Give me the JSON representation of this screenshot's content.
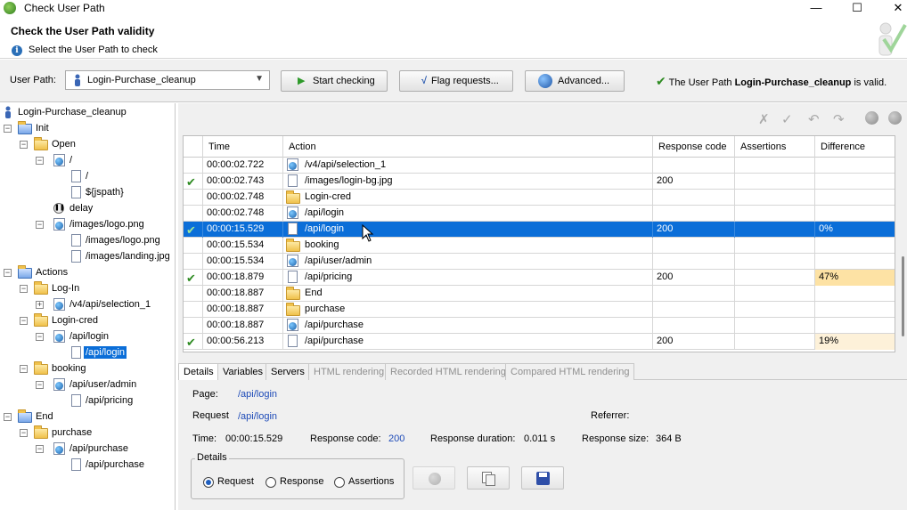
{
  "window": {
    "title": "Check User Path",
    "minimize": "—",
    "maximize": "☐",
    "close": "✕"
  },
  "header": {
    "title": "Check the User Path validity",
    "subtitle": "Select the User Path to check"
  },
  "toolbar": {
    "user_path_label": "User Path:",
    "user_path_value": "Login-Purchase_cleanup",
    "start_checking": "Start checking",
    "flag_requests": "Flag requests...",
    "advanced": "Advanced...",
    "valid_prefix": "The User Path ",
    "valid_name": "Login-Purchase_cleanup",
    "valid_suffix": " is valid."
  },
  "tree": {
    "root": "Login-Purchase_cleanup",
    "init": "Init",
    "open": "Open",
    "slash": "/",
    "slash_child": "/",
    "jspath": "${jspath}",
    "delay": "delay",
    "images_logo": "/images/logo.png",
    "images_logo_child": "/images/logo.png",
    "images_landing": "/images/landing.jpg",
    "actions": "Actions",
    "log_in": "Log-In",
    "selection_1": "/v4/api/selection_1",
    "login_cred": "Login-cred",
    "api_login": "/api/login",
    "api_login_child": "/api/login",
    "booking": "booking",
    "api_user_admin": "/api/user/admin",
    "api_pricing": "/api/pricing",
    "end": "End",
    "purchase": "purchase",
    "api_purchase": "/api/purchase",
    "api_purchase_child": "/api/purchase"
  },
  "grid": {
    "columns": [
      "Time",
      "Action",
      "Response code",
      "Assertions",
      "Difference"
    ],
    "rows": [
      {
        "check": "",
        "time": "00:00:02.722",
        "icon": "globe",
        "action": "/v4/api/selection_1",
        "code": "",
        "assertions": "",
        "difference": ""
      },
      {
        "check": "✔",
        "time": "00:00:02.743",
        "icon": "page",
        "action": "/images/login-bg.jpg",
        "code": "200",
        "assertions": "",
        "difference": ""
      },
      {
        "check": "",
        "time": "00:00:02.748",
        "icon": "folder",
        "action": "Login-cred",
        "code": "",
        "assertions": "",
        "difference": ""
      },
      {
        "check": "",
        "time": "00:00:02.748",
        "icon": "globe",
        "action": "/api/login",
        "code": "",
        "assertions": "",
        "difference": ""
      },
      {
        "check": "✔",
        "time": "00:00:15.529",
        "icon": "page",
        "action": "/api/login",
        "code": "200",
        "assertions": "",
        "difference": "0%"
      },
      {
        "check": "",
        "time": "00:00:15.534",
        "icon": "folder",
        "action": "booking",
        "code": "",
        "assertions": "",
        "difference": ""
      },
      {
        "check": "",
        "time": "00:00:15.534",
        "icon": "globe",
        "action": "/api/user/admin",
        "code": "",
        "assertions": "",
        "difference": ""
      },
      {
        "check": "✔",
        "time": "00:00:18.879",
        "icon": "page",
        "action": "/api/pricing",
        "code": "200",
        "assertions": "",
        "difference": "47%"
      },
      {
        "check": "",
        "time": "00:00:18.887",
        "icon": "folder",
        "action": "End",
        "code": "",
        "assertions": "",
        "difference": ""
      },
      {
        "check": "",
        "time": "00:00:18.887",
        "icon": "folder",
        "action": "purchase",
        "code": "",
        "assertions": "",
        "difference": ""
      },
      {
        "check": "",
        "time": "00:00:18.887",
        "icon": "globe",
        "action": "/api/purchase",
        "code": "",
        "assertions": "",
        "difference": ""
      },
      {
        "check": "✔",
        "time": "00:00:56.213",
        "icon": "page",
        "action": "/api/purchase",
        "code": "200",
        "assertions": "",
        "difference": "19%"
      }
    ]
  },
  "tabs": [
    "Details",
    "Variables",
    "Servers",
    "HTML rendering",
    "Recorded HTML rendering",
    "Compared HTML rendering"
  ],
  "details": {
    "page_label": "Page:",
    "page_value": "/api/login",
    "request_label": "Request",
    "request_value": "/api/login",
    "referrer_label": "Referrer:",
    "time_label": "Time:",
    "time_value": "00:00:15.529",
    "response_code_label": "Response code:",
    "response_code_value": "200",
    "response_duration_label": "Response duration:",
    "response_duration_value": "0.011 s",
    "response_size_label": "Response size:",
    "response_size_value": "364 B",
    "group_label": "Details",
    "radio_request": "Request",
    "radio_response": "Response",
    "radio_assertions": "Assertions"
  },
  "colors": {
    "selection": "#0b6ed8",
    "diff_high": "#fde2a4",
    "diff_low": "#fdf1d9",
    "valid_check": "#2e8b22",
    "link": "#1e4bb8"
  }
}
